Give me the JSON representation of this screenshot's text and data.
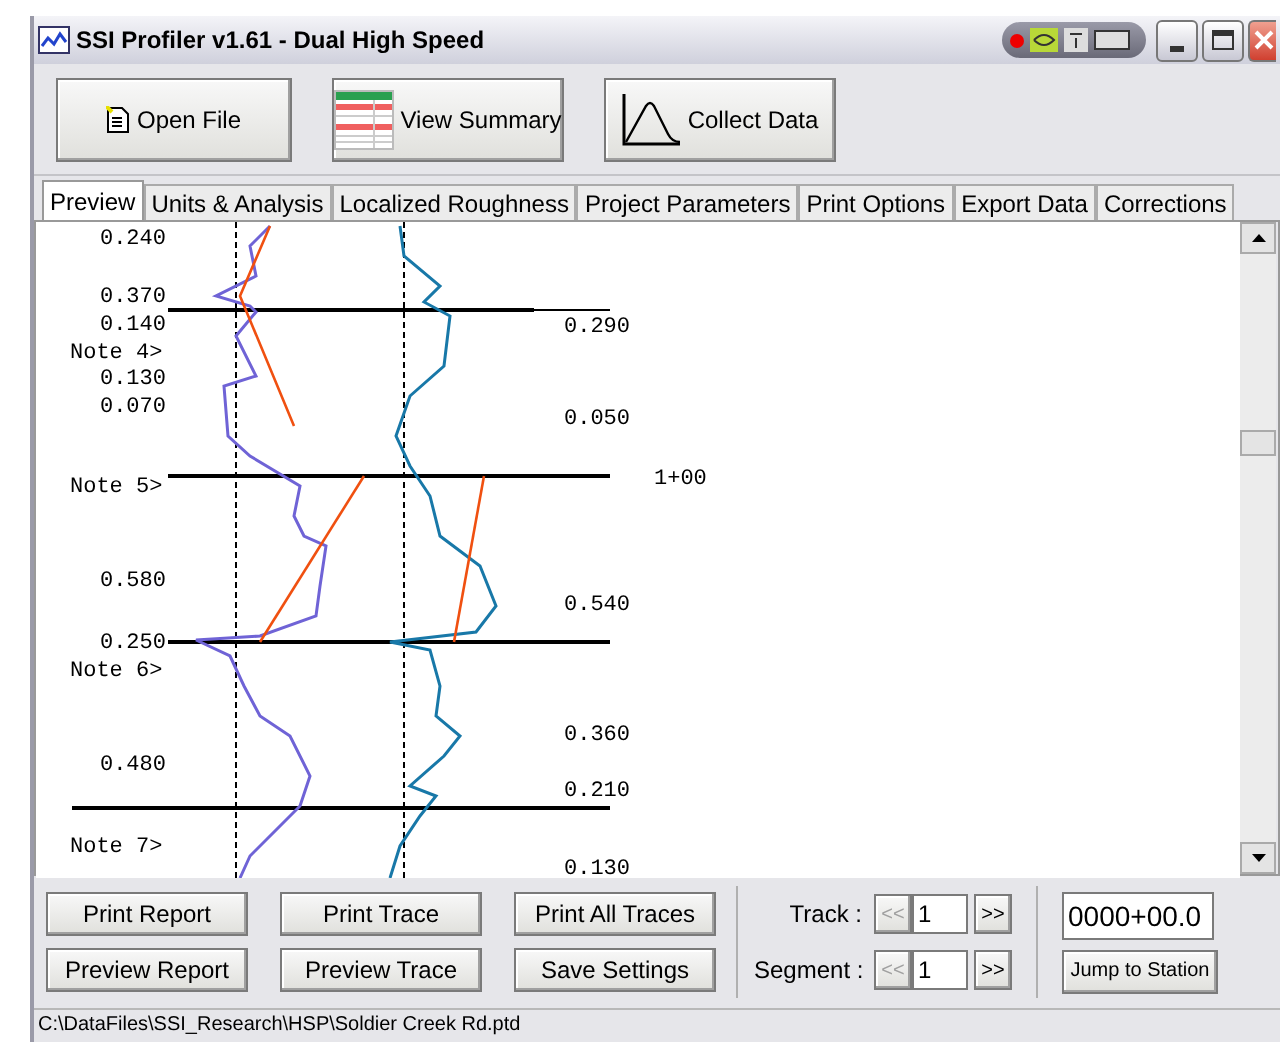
{
  "window": {
    "title": "SSI Profiler v1.61 - Dual High Speed"
  },
  "toolbar": [
    {
      "kind": "open",
      "label": "Open File"
    },
    {
      "kind": "summary",
      "label": "View Summary"
    },
    {
      "kind": "collect",
      "label": "Collect Data"
    }
  ],
  "tabs": [
    {
      "label": "Preview",
      "selected": true
    },
    {
      "label": "Units & Analysis",
      "selected": false
    },
    {
      "label": "Localized Roughness",
      "selected": false
    },
    {
      "label": "Project Parameters",
      "selected": false
    },
    {
      "label": "Print Options",
      "selected": false
    },
    {
      "label": "Export Data",
      "selected": false
    },
    {
      "label": "Corrections",
      "selected": false
    }
  ],
  "profile": {
    "left_labels": [
      {
        "kind": "value",
        "text": "0.240"
      },
      {
        "kind": "value",
        "text": "0.370"
      },
      {
        "kind": "value",
        "text": "0.140"
      },
      {
        "kind": "note",
        "text": "Note 4>"
      },
      {
        "kind": "value",
        "text": "0.130"
      },
      {
        "kind": "value",
        "text": "0.070"
      },
      {
        "kind": "note",
        "text": "Note 5>"
      },
      {
        "kind": "value",
        "text": "0.580"
      },
      {
        "kind": "value",
        "text": "0.250"
      },
      {
        "kind": "note",
        "text": "Note 6>"
      },
      {
        "kind": "value",
        "text": "0.480"
      },
      {
        "kind": "note",
        "text": "Note 7>"
      }
    ],
    "right_labels": [
      "0.290",
      "0.050",
      "0.540",
      "0.360",
      "0.210",
      "0.130"
    ],
    "station_label": "1+00"
  },
  "bottom": {
    "buttons": [
      "Print Report",
      "Print Trace",
      "Print All Traces",
      "Preview Report",
      "Preview Trace",
      "Save Settings"
    ],
    "steppers": [
      {
        "label": "Track :",
        "value": "1",
        "prev": {
          "text": "<<",
          "disabled": true
        },
        "next": {
          "text": ">>",
          "disabled": false
        }
      },
      {
        "label": "Segment :",
        "value": "1",
        "prev": {
          "text": "<<",
          "disabled": true
        },
        "next": {
          "text": ">>",
          "disabled": false
        }
      }
    ],
    "station": {
      "value": "0000+00.0"
    },
    "jump_button": "Jump to Station"
  },
  "status_bar": "C:\\DataFiles\\SSI_Research\\HSP\\Soldier Creek Rd.ptd"
}
